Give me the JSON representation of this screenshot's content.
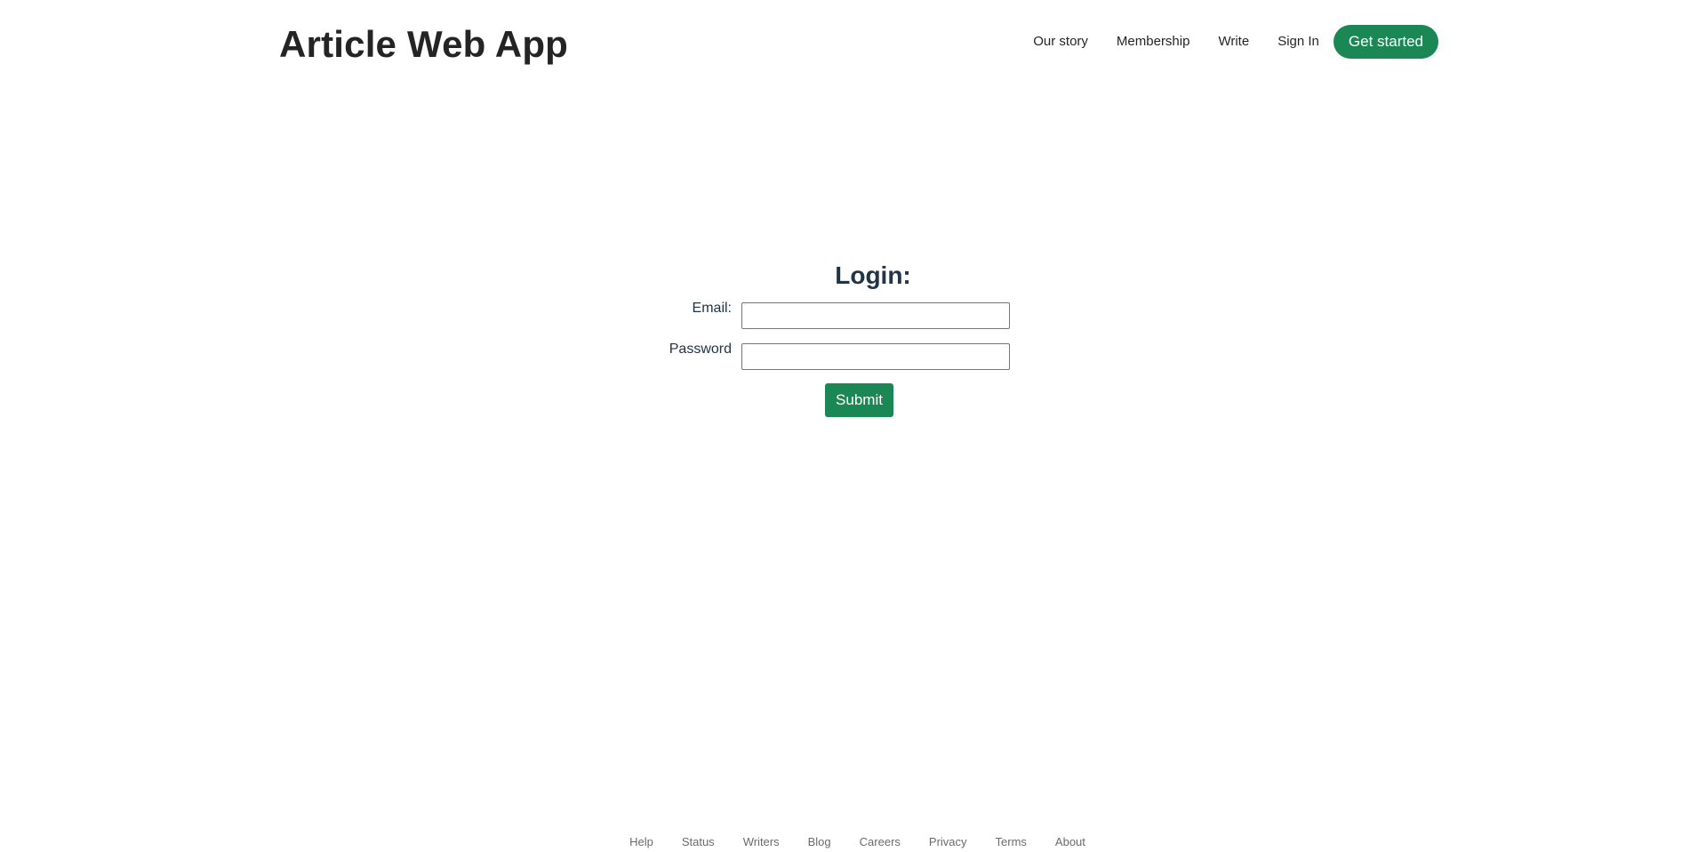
{
  "header": {
    "title": "Article Web App",
    "nav": [
      {
        "label": "Our story"
      },
      {
        "label": "Membership"
      },
      {
        "label": "Write"
      },
      {
        "label": "Sign In"
      }
    ],
    "cta_label": "Get started"
  },
  "login": {
    "title": "Login:",
    "email_label": "Email:",
    "email_value": "",
    "password_label": "Password",
    "password_value": "",
    "submit_label": "Submit"
  },
  "footer": {
    "links": [
      {
        "label": "Help"
      },
      {
        "label": "Status"
      },
      {
        "label": "Writers"
      },
      {
        "label": "Blog"
      },
      {
        "label": "Careers"
      },
      {
        "label": "Privacy"
      },
      {
        "label": "Terms"
      },
      {
        "label": "About"
      }
    ]
  },
  "colors": {
    "accent": "#1a8754",
    "heading": "#213547",
    "footer_text": "#6b6b6b"
  }
}
